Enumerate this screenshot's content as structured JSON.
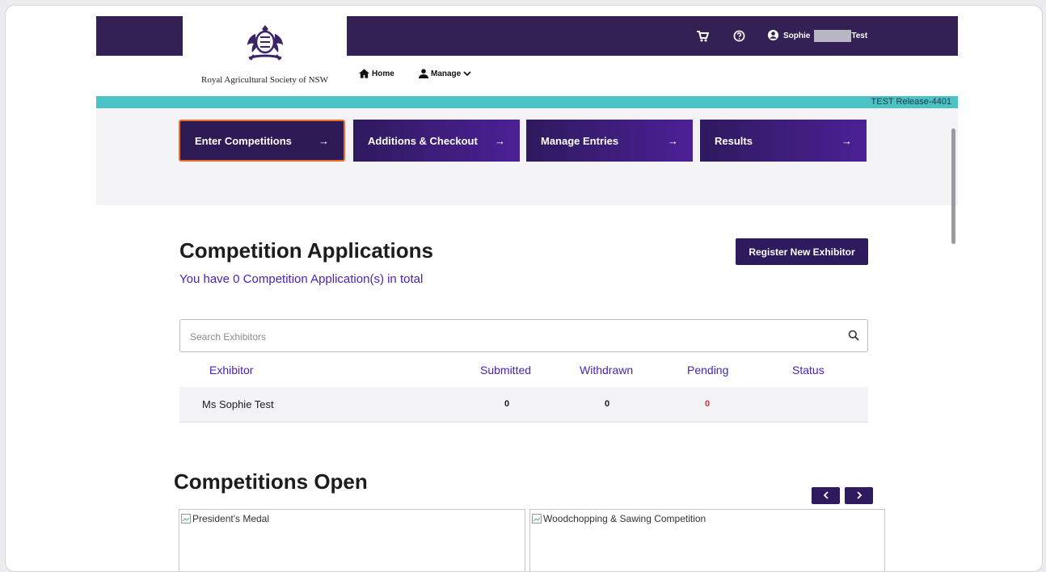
{
  "header": {
    "org_name": "Royal Agricultural Society of NSW",
    "nav": [
      {
        "label": "Home",
        "icon": "home-icon"
      },
      {
        "label": "Manage",
        "icon": "user-icon"
      }
    ],
    "cart_icon": "cart-icon",
    "help_icon": "help-icon",
    "user_first": "Sophie",
    "user_last": "Test",
    "release": "TEST Release-4401"
  },
  "steps": [
    {
      "label": "Enter Competitions",
      "arrow": "→",
      "active": true
    },
    {
      "label": "Additions & Checkout",
      "arrow": "→",
      "active": false
    },
    {
      "label": "Manage Entries",
      "arrow": "→",
      "active": false
    },
    {
      "label": "Results",
      "arrow": "→",
      "active": false
    }
  ],
  "applications": {
    "title": "Competition Applications",
    "subtitle": "You have 0 Competition Application(s) in total",
    "register_label": "Register New Exhibitor",
    "search_placeholder": "Search Exhibitors",
    "columns": [
      "Exhibitor",
      "Submitted",
      "Withdrawn",
      "Pending",
      "Status"
    ],
    "rows": [
      {
        "exhibitor": "Ms Sophie Test",
        "submitted": "0",
        "withdrawn": "0",
        "pending": "0",
        "status": ""
      }
    ]
  },
  "competitions": {
    "title": "Competitions Open",
    "prev_icon": "chevron-left-icon",
    "next_icon": "chevron-right-icon",
    "cards": [
      {
        "alt": "President's Medal"
      },
      {
        "alt": "Woodchopping & Sawing Competition"
      }
    ]
  },
  "colors": {
    "brand": "#332055",
    "accent_teal": "#4bc2c6",
    "link_purple": "#4a22b8",
    "active_outline": "#f06e2a",
    "pending_red": "#e03030"
  }
}
